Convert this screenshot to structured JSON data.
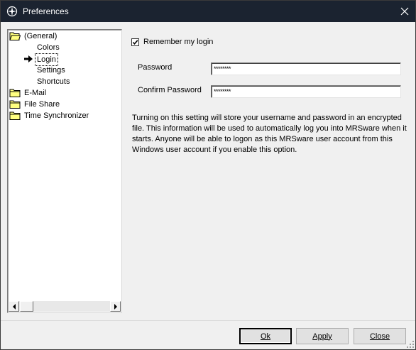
{
  "window": {
    "title": "Preferences"
  },
  "tree": {
    "items": [
      {
        "label": "(General)",
        "icon": "folder-open-icon"
      },
      {
        "label": "Colors"
      },
      {
        "label": "Login",
        "icon": "arrow-right-icon",
        "selected": true
      },
      {
        "label": "Settings"
      },
      {
        "label": "Shortcuts"
      },
      {
        "label": "E-Mail",
        "icon": "folder-icon"
      },
      {
        "label": "File Share",
        "icon": "folder-icon"
      },
      {
        "label": "Time Synchronizer",
        "icon": "folder-icon"
      }
    ]
  },
  "login": {
    "remember_label": "Remember my login",
    "remember_checked": true,
    "password_label": "Password",
    "password_value": "********",
    "confirm_label": "Confirm Password",
    "confirm_value": "********",
    "description": "Turning on this setting will store your username and password in an encrypted file.  This information will be used to automatically log you into MRSware when it starts.  Anyone will be able to logon as this MRSware user account from this Windows user account if you enable this option."
  },
  "buttons": {
    "ok": "Ok",
    "apply": "Apply",
    "close": "Close"
  },
  "colors": {
    "titlebar": "#1b2330",
    "folder": "#ffff80"
  }
}
